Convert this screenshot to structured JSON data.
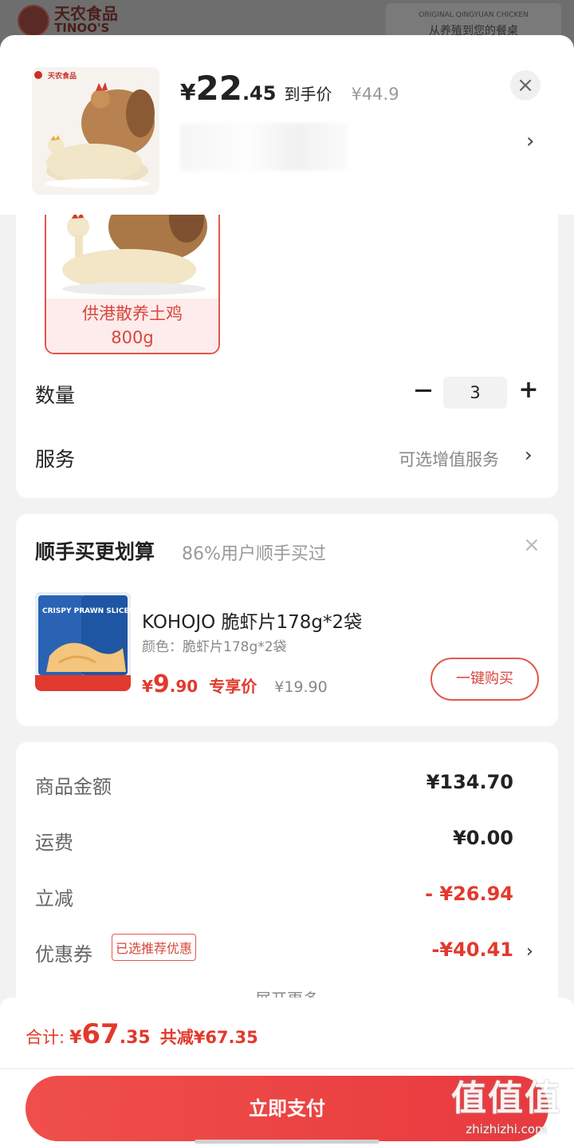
{
  "background_page": {
    "brand_cn": "天农食品",
    "brand_en": "TINOO'S",
    "banner_small": "ORIGINAL QINGYUAN CHICKEN",
    "banner_big": "从养殖到您的餐桌"
  },
  "product": {
    "price_currency": "¥",
    "price_integer": "22",
    "price_decimal": ".45",
    "price_tag": "到手价",
    "original_price": "¥44.9",
    "close_icon": "×",
    "chevron": "›"
  },
  "variant": {
    "label_line1": "供港散养土鸡",
    "label_line2": "800g"
  },
  "quantity": {
    "label": "数量",
    "value": "3",
    "plus": "+"
  },
  "service": {
    "label": "服务",
    "value": "可选增值服务",
    "chevron": "›"
  },
  "upsell": {
    "title": "顺手买更划算",
    "subtitle": "86%用户顺手买过",
    "close_icon": "×",
    "product_name": "KOHOJO 脆虾片178g*2袋",
    "color_text": "颜色：脆虾片178g*2袋",
    "price_currency": "¥",
    "price_integer": "9",
    "price_decimal": ".90",
    "price_tag": "专享价",
    "original_price": "¥19.90",
    "buy_button": "一键购买",
    "image_text": "CRISPY PRAWN SLICES"
  },
  "summary": {
    "rows": [
      {
        "label": "商品金额",
        "value": "¥134.70"
      },
      {
        "label": "运费",
        "value": "¥0.00"
      },
      {
        "label": "立减",
        "value": "- ¥26.94"
      },
      {
        "label": "优惠券",
        "value": "-¥40.41"
      }
    ],
    "coupon_tag": "已选推荐优惠",
    "coupon_chevron": "›",
    "expand_more": "展开更多"
  },
  "bottom": {
    "total_label": "合计:",
    "total_currency": "¥",
    "total_integer": "67",
    "total_decimal": ".35",
    "saved_text": "共减¥67.35",
    "pay_button": "立即支付"
  },
  "watermark": {
    "logo": "值值值",
    "url": "zhizhizhi.com"
  },
  "colors": {
    "accent": "#e2392c",
    "accent_light": "#fdeceb"
  }
}
